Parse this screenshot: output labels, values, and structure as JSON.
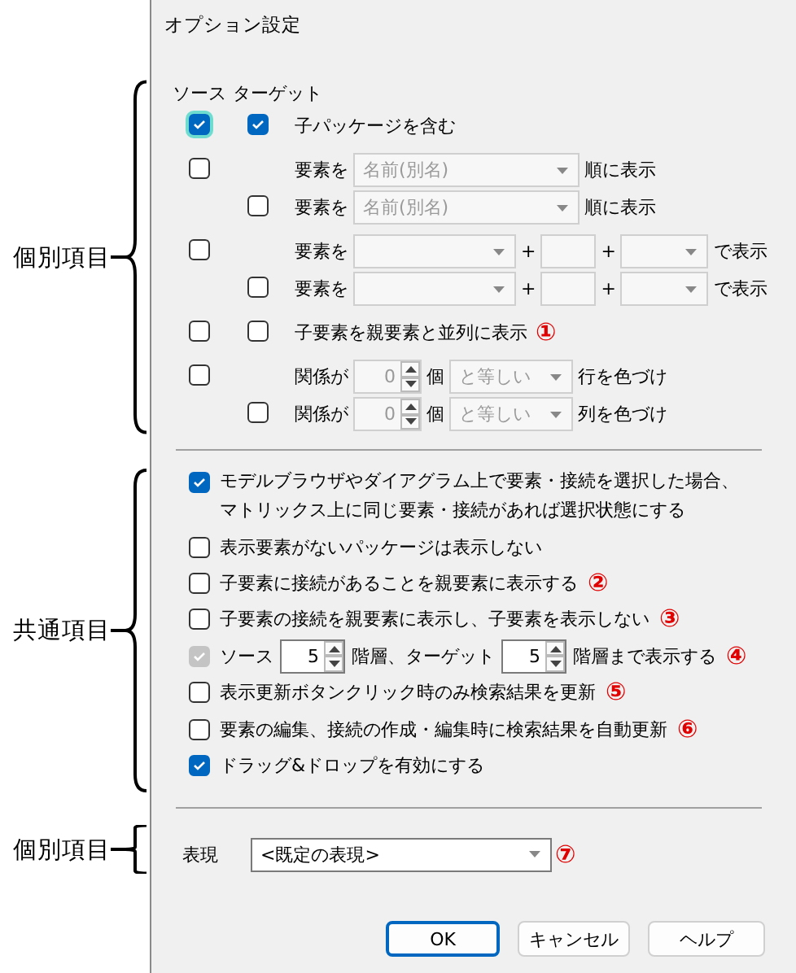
{
  "window": {
    "title": "オプション設定"
  },
  "individual": {
    "annotation": "個別項目",
    "header": {
      "source": "ソース",
      "target": "ターゲット"
    },
    "rows": [
      {
        "kind": "check",
        "source": {
          "checked": true,
          "focused": true
        },
        "target": {
          "checked": true
        },
        "label": "子パッケージを含む"
      },
      {
        "kind": "sort",
        "source": {
          "checked": false
        },
        "prefix": "要素を",
        "combo": {
          "value": "名前(別名)",
          "disabled": true
        },
        "suffix": "順に表示"
      },
      {
        "kind": "sort",
        "target": {
          "checked": false
        },
        "prefix": "要素を",
        "combo": {
          "value": "名前(別名)",
          "disabled": true
        },
        "suffix": "順に表示"
      },
      {
        "kind": "compose",
        "source": {
          "checked": false
        },
        "prefix": "要素を",
        "combo_1": {
          "disabled": true
        },
        "plus_1": "+",
        "field": {
          "disabled": true
        },
        "plus_2": "+",
        "combo_2": {
          "disabled": true
        },
        "suffix": "で表示"
      },
      {
        "kind": "compose",
        "target": {
          "checked": false
        },
        "prefix": "要素を",
        "combo_1": {
          "disabled": true
        },
        "plus_1": "+",
        "field": {
          "disabled": true
        },
        "plus_2": "+",
        "combo_2": {
          "disabled": true
        },
        "suffix": "で表示"
      },
      {
        "kind": "check",
        "source": {
          "checked": false
        },
        "target": {
          "checked": false
        },
        "label": "子要素を親要素と並列に表示",
        "badge": "①"
      },
      {
        "kind": "color",
        "source": {
          "checked": false
        },
        "prefix": "関係が",
        "spinner": {
          "value": "0",
          "disabled": true
        },
        "unit": "個",
        "combo": {
          "value": "と等しい",
          "disabled": true
        },
        "suffix": "行を色づけ"
      },
      {
        "kind": "color",
        "target": {
          "checked": false
        },
        "prefix": "関係が",
        "spinner": {
          "value": "0",
          "disabled": true
        },
        "unit": "個",
        "combo": {
          "value": "と等しい",
          "disabled": true
        },
        "suffix": "列を色づけ"
      }
    ]
  },
  "common": {
    "annotation": "共通項目",
    "items": [
      {
        "kind": "check",
        "checked": true,
        "lines": [
          "モデルブラウザやダイアグラム上で要素・接続を選択した場合、",
          "マトリックス上に同じ要素・接続があれば選択状態にする"
        ]
      },
      {
        "kind": "check",
        "checked": false,
        "label": "表示要素がないパッケージは表示しない"
      },
      {
        "kind": "check",
        "checked": false,
        "label": "子要素に接続があることを親要素に表示する",
        "badge": "②"
      },
      {
        "kind": "check",
        "checked": false,
        "label": "子要素の接続を親要素に表示し、子要素を表示しない",
        "badge": "③"
      },
      {
        "kind": "depth",
        "checked": true,
        "disabled": true,
        "label_1": "ソース",
        "spinner_1": {
          "value": "5",
          "disabled": false
        },
        "label_2": "階層、ターゲット",
        "spinner_2": {
          "value": "5",
          "disabled": false
        },
        "label_3": "階層まで表示する",
        "badge": "④"
      },
      {
        "kind": "check",
        "checked": false,
        "label": "表示更新ボタンクリック時のみ検索結果を更新",
        "badge": "⑤"
      },
      {
        "kind": "check",
        "checked": false,
        "label": "要素の編集、接続の作成・編集時に検索結果を自動更新",
        "badge": "⑥"
      },
      {
        "kind": "check",
        "checked": true,
        "label": "ドラッグ&ドロップを有効にする"
      }
    ]
  },
  "representation": {
    "annotation": "個別項目",
    "label": "表現",
    "combo": {
      "value": "<既定の表現>",
      "disabled": false
    },
    "badge": "⑦"
  },
  "buttons": [
    {
      "label": "OK",
      "default": true
    },
    {
      "label": "キャンセル",
      "default": false
    },
    {
      "label": "ヘルプ",
      "default": false
    }
  ]
}
